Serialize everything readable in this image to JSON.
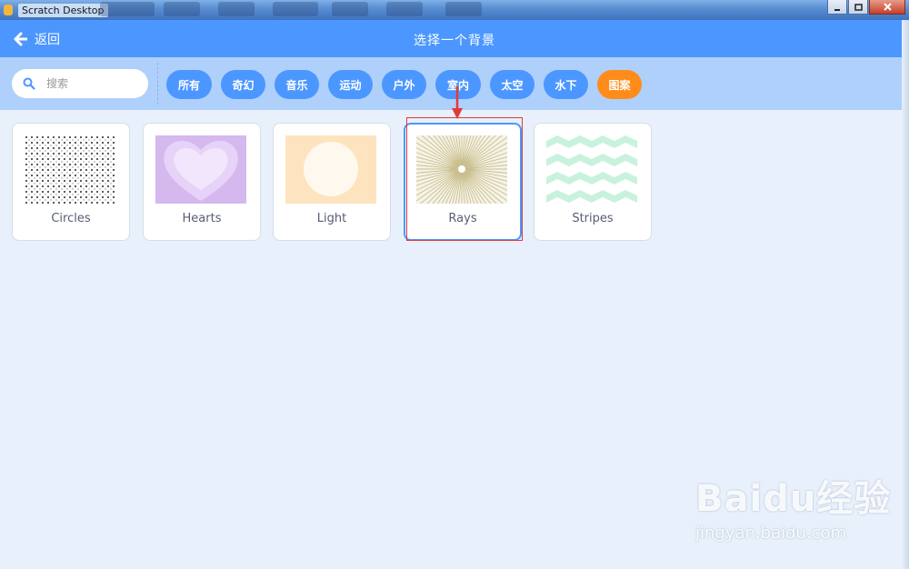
{
  "window": {
    "title": "Scratch Desktop"
  },
  "header": {
    "back_label": "返回",
    "title": "选择一个背景"
  },
  "search": {
    "placeholder": "搜索",
    "value": ""
  },
  "tags": [
    {
      "label": "所有"
    },
    {
      "label": "奇幻"
    },
    {
      "label": "音乐"
    },
    {
      "label": "运动"
    },
    {
      "label": "户外"
    },
    {
      "label": "室内"
    },
    {
      "label": "太空"
    },
    {
      "label": "水下"
    },
    {
      "label": "图案"
    }
  ],
  "active_tag": "图案",
  "backdrops": [
    {
      "name": "Circles"
    },
    {
      "name": "Hearts"
    },
    {
      "name": "Light"
    },
    {
      "name": "Rays"
    },
    {
      "name": "Stripes"
    }
  ],
  "selected_backdrop": "Rays",
  "watermark": {
    "brand": "Baidu经验",
    "url": "jingyan.baidu.com"
  },
  "colors": {
    "header": "#4c97ff",
    "filterbar": "#aed0fb",
    "tag": "#4c97ff",
    "tag_active": "#ff8c1a",
    "background": "#e8f0fb",
    "annotation": "#e23a3a"
  },
  "icons": {
    "back": "arrow-left-icon",
    "search": "search-icon"
  }
}
